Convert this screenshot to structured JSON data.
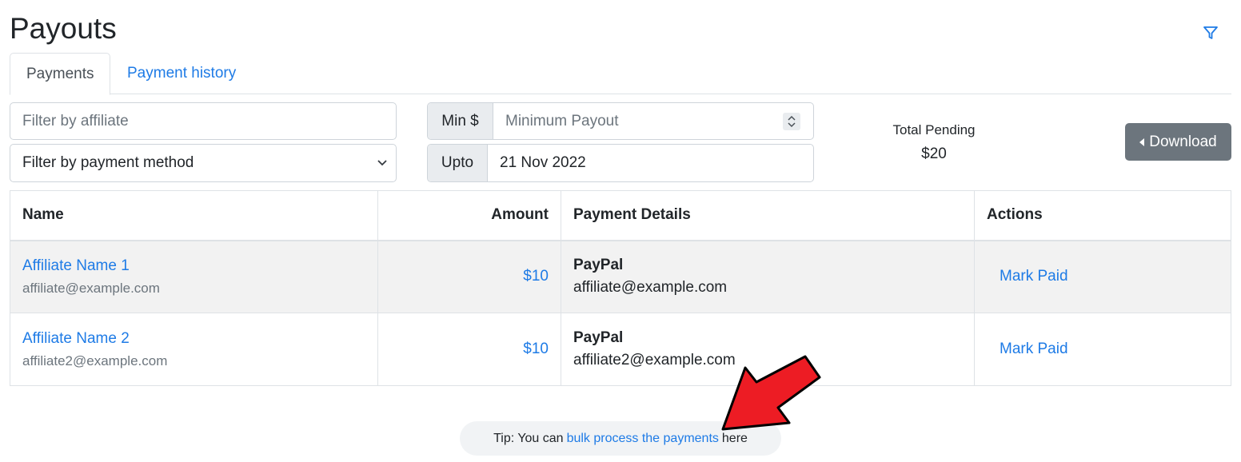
{
  "page": {
    "title": "Payouts"
  },
  "icons": {
    "filter": "filter-icon",
    "chevron": "chevron-down-icon",
    "spinner": "number-spinner-icon",
    "caret": "caret-left-icon",
    "annotation": "red-arrow-annotation"
  },
  "tabs": [
    {
      "label": "Payments",
      "active": true
    },
    {
      "label": "Payment history",
      "active": false
    }
  ],
  "filters": {
    "affiliate_placeholder": "Filter by affiliate",
    "payment_method_selected": "Filter by payment method",
    "min_addon": "Min $",
    "min_placeholder": "Minimum Payout",
    "upto_addon": "Upto",
    "upto_value": "21 Nov 2022"
  },
  "summary": {
    "total_label": "Total Pending",
    "total_value": "$20"
  },
  "download": {
    "label": "Download"
  },
  "table": {
    "headers": {
      "name": "Name",
      "amount": "Amount",
      "details": "Payment Details",
      "actions": "Actions"
    },
    "rows": [
      {
        "name": "Affiliate Name 1",
        "email": "affiliate@example.com",
        "amount": "$10",
        "method": "PayPal",
        "method_email": "affiliate@example.com",
        "action": "Mark Paid"
      },
      {
        "name": "Affiliate Name 2",
        "email": "affiliate2@example.com",
        "amount": "$10",
        "method": "PayPal",
        "method_email": "affiliate2@example.com",
        "action": "Mark Paid"
      }
    ]
  },
  "tip": {
    "prefix": "Tip: You can",
    "link": "bulk process the payments",
    "suffix": "here"
  },
  "colors": {
    "link": "#1e7be6",
    "button": "#6c757d",
    "arrow": "#ed1c24",
    "row_shade": "#f2f2f2"
  }
}
